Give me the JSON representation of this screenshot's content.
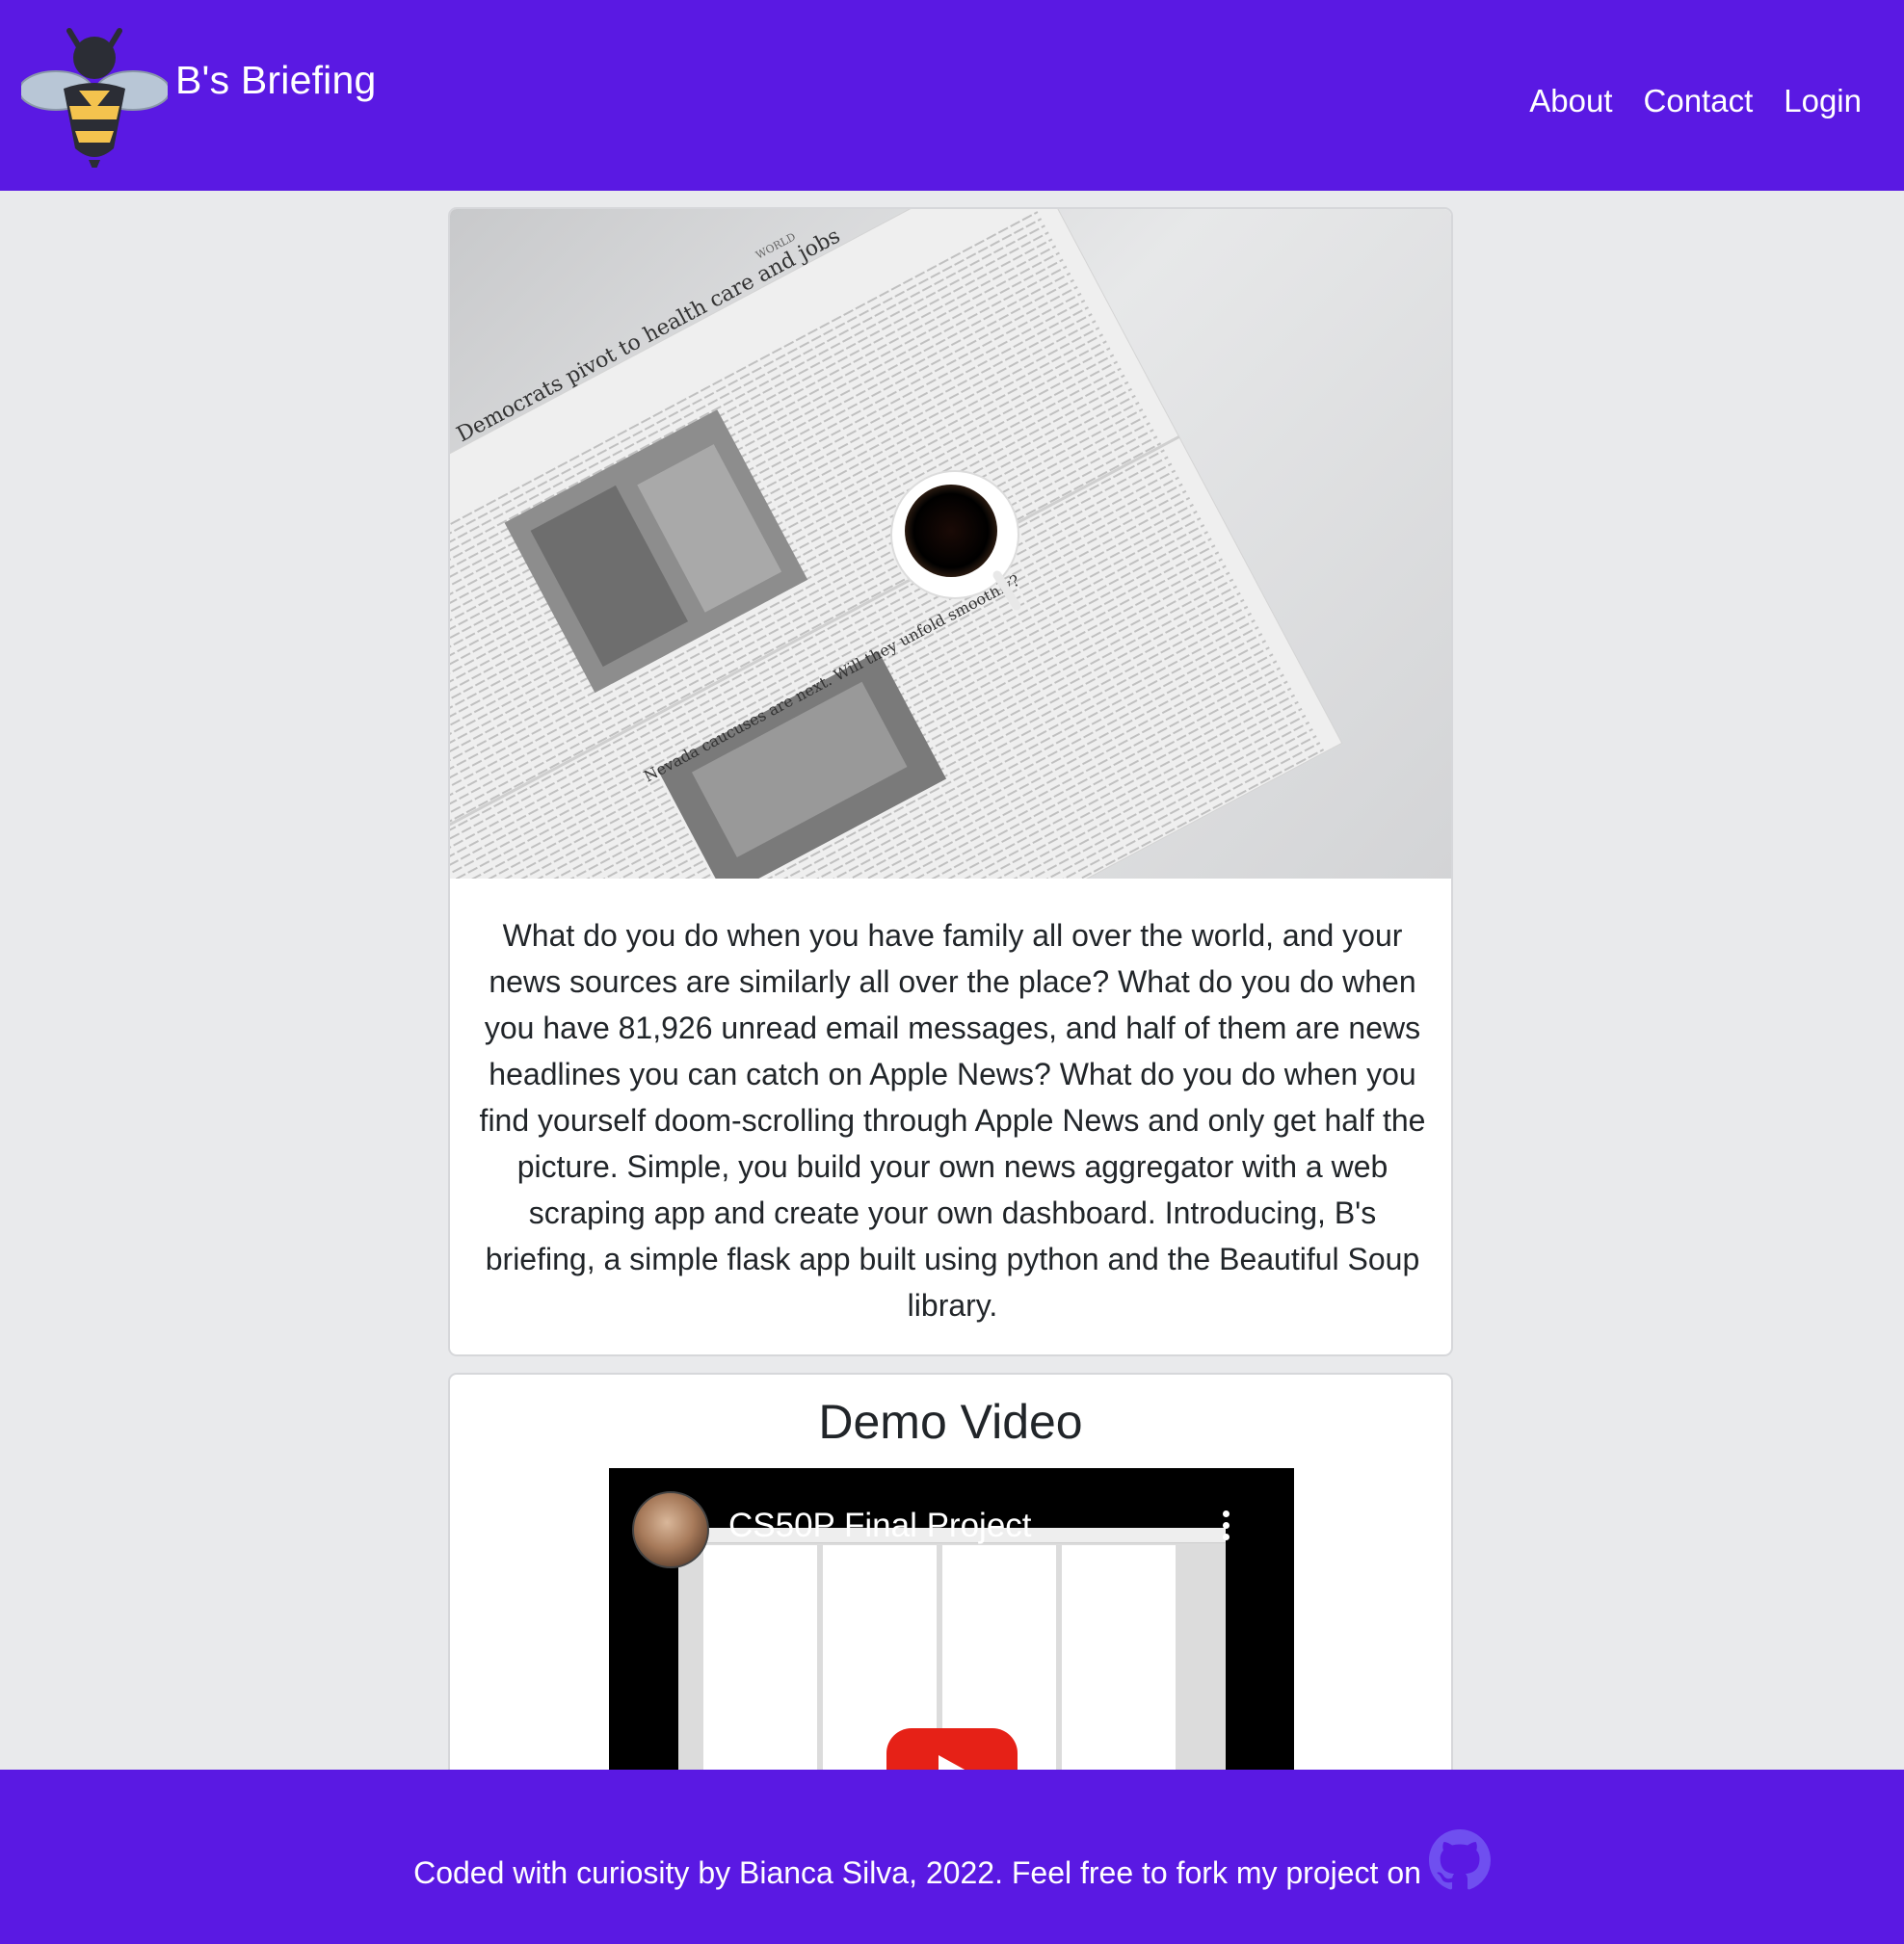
{
  "navbar": {
    "brand": "B's Briefing",
    "links": [
      "About",
      "Contact",
      "Login"
    ]
  },
  "hero": {
    "image": "newspaper-coffee-photo",
    "image_headlines": [
      "Democrats pivot to health care and jobs",
      "Nevada caucuses are next. Will they unfold smoothly?",
      "WORLD"
    ],
    "description": "What do you do when you have family all over the world, and your news sources are similarly all over the place? What do you do when you have 81,926 unread email messages, and half of them are news headlines you can catch on Apple News? What do you do when you find yourself doom-scrolling through Apple News and only get half the picture. Simple, you build your own news aggregator with a web scraping app and create your own dashboard. Introducing, B's briefing, a simple flask app built using python and the Beautiful Soup library."
  },
  "demo": {
    "title": "Demo Video",
    "video_title": "CS50P Final Project"
  },
  "footer": {
    "text": "Coded with curiosity by Bianca Silva, 2022. Feel free to fork my project on",
    "icon": "github-icon"
  },
  "colors": {
    "brand": "#5a19e3",
    "background": "#e9eaec",
    "card": "#ffffff"
  }
}
